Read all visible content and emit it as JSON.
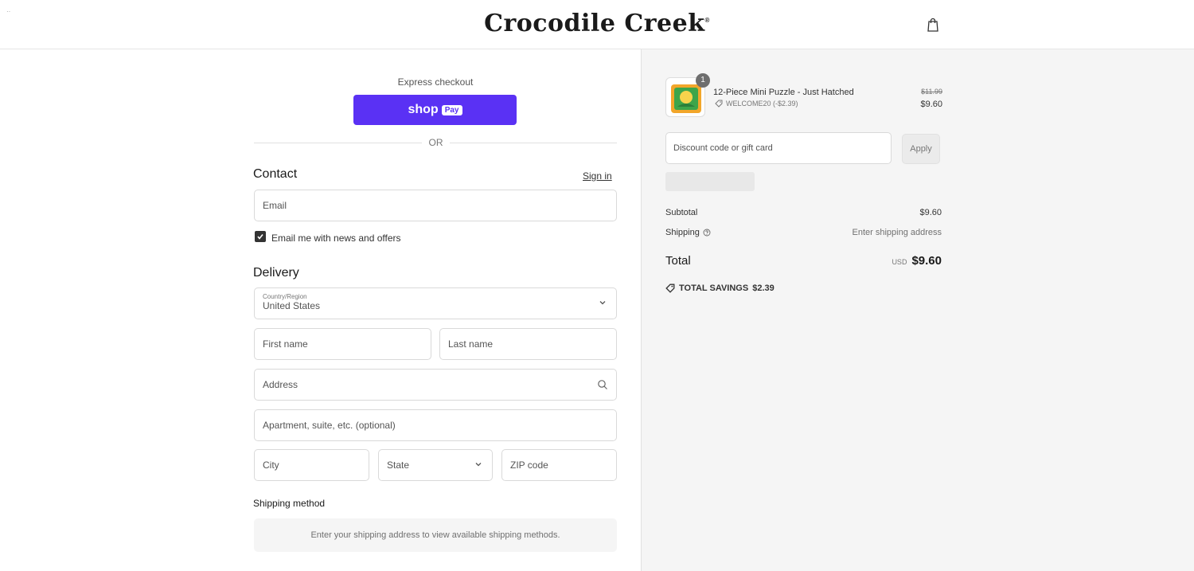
{
  "header": {
    "corner_text": "··",
    "logo": "Crocodile Creek",
    "logo_mark": "®",
    "cart_icon": "shopping-bag-icon"
  },
  "express": {
    "label": "Express checkout",
    "shop_label": "shop",
    "pay_label": "Pay",
    "or_label": "OR"
  },
  "contact": {
    "title": "Contact",
    "signin_link": "Sign in",
    "email_placeholder": "Email",
    "newsletter_label": "Email me with news and offers"
  },
  "delivery": {
    "title": "Delivery",
    "country_label": "Country/Region",
    "country_value": "United States",
    "first_name_placeholder": "First name",
    "last_name_placeholder": "Last name",
    "address_placeholder": "Address",
    "apartment_placeholder": "Apartment, suite, etc. (optional)",
    "city_placeholder": "City",
    "state_placeholder": "State",
    "zip_placeholder": "ZIP code"
  },
  "shipping": {
    "title": "Shipping method",
    "note": "Enter your shipping address to view available shipping methods."
  },
  "summary": {
    "product": {
      "name": "12-Piece Mini Puzzle - Just Hatched",
      "quantity": "1",
      "discount_code": "WELCOME20 (-$2.39)",
      "original_price": "$11.99",
      "price": "$9.60"
    },
    "discount_placeholder": "Discount code or gift card",
    "apply_label": "Apply",
    "subtotal_label": "Subtotal",
    "subtotal_value": "$9.60",
    "shipping_label": "Shipping",
    "shipping_value": "Enter shipping address",
    "total_label": "Total",
    "currency": "USD",
    "total_value": "$9.60",
    "savings_label": "TOTAL SAVINGS",
    "savings_value": "$2.39"
  },
  "colors": {
    "shop_pay": "#5a31f4",
    "sidebar_bg": "#f5f5f5"
  }
}
